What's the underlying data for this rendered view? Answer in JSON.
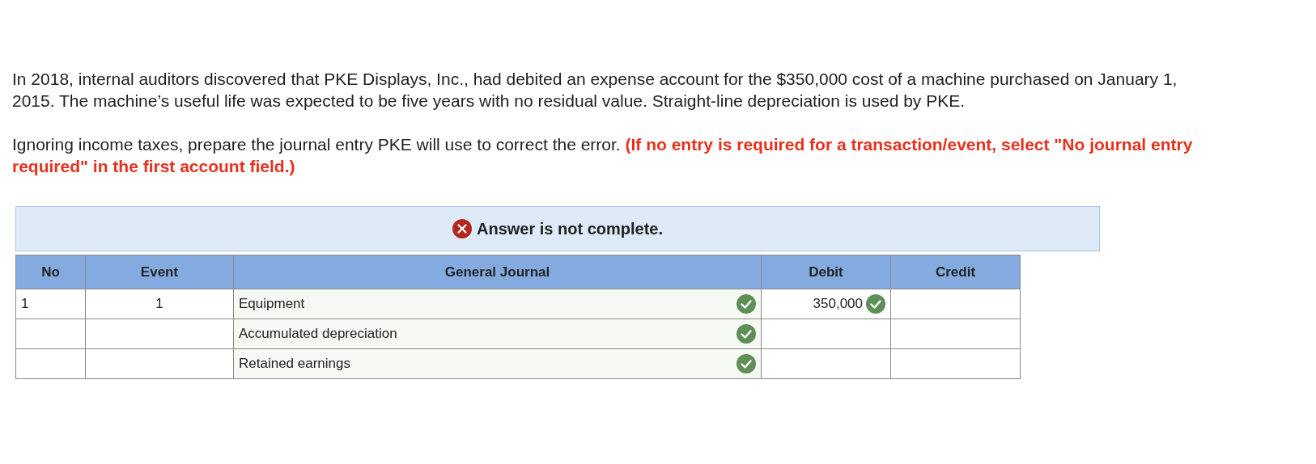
{
  "problem": "In 2018, internal auditors discovered that PKE Displays, Inc., had debited an expense account for the $350,000 cost of a machine purchased on January 1, 2015. The machine’s useful life was expected to be five years with no residual value. Straight-line depreciation is used by PKE.",
  "instruction": {
    "text": "Ignoring income taxes, prepare the journal entry PKE will use to correct the error.",
    "note": "(If no entry is required for a transaction/event, select \"No journal entry required\" in the first account field.)"
  },
  "status": {
    "complete": false,
    "text": "Answer is not complete."
  },
  "table": {
    "columns": [
      "No",
      "Event",
      "General Journal",
      "Debit",
      "Credit"
    ],
    "rows": [
      {
        "no": "1",
        "event": "1",
        "account": "Equipment",
        "account_correct": true,
        "debit": "350,000",
        "debit_correct": true,
        "credit": ""
      },
      {
        "no": "",
        "event": "",
        "account": "Accumulated depreciation",
        "account_correct": true,
        "debit": "",
        "debit_correct": false,
        "credit": ""
      },
      {
        "no": "",
        "event": "",
        "account": "Retained earnings",
        "account_correct": true,
        "debit": "",
        "debit_correct": false,
        "credit": ""
      }
    ]
  }
}
